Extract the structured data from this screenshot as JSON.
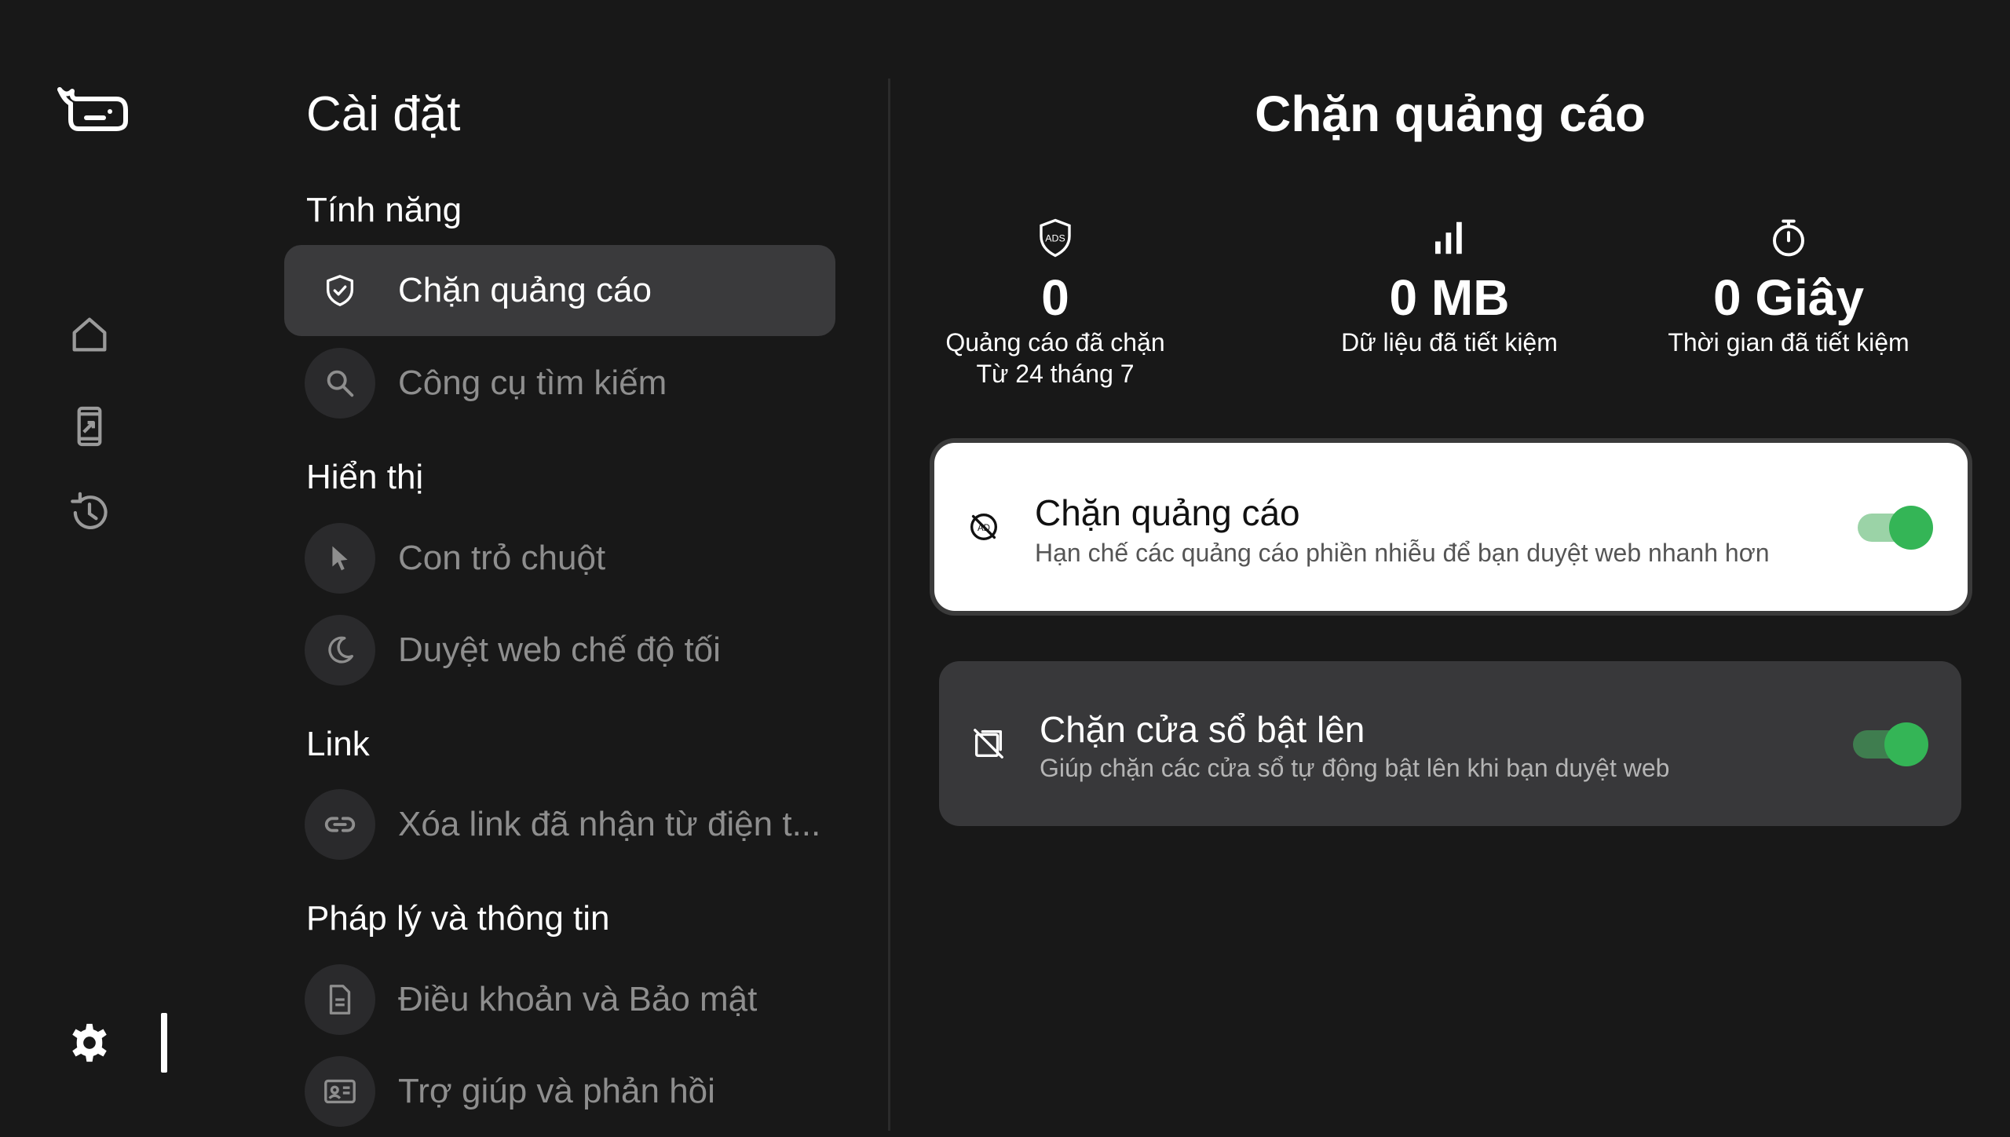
{
  "settings": {
    "title": "Cài đặt",
    "sections": {
      "features": "Tính năng",
      "display": "Hiển thị",
      "link": "Link",
      "legal": "Pháp lý và thông tin"
    },
    "items": {
      "adblock": "Chặn quảng cáo",
      "search": "Công cụ tìm kiếm",
      "cursor": "Con trỏ chuột",
      "dark": "Duyệt web chế độ tối",
      "clear_link": "Xóa link đã nhận từ điện t...",
      "terms": "Điều khoản và Bảo mật",
      "help": "Trợ giúp và phản hồi"
    }
  },
  "panel": {
    "title": "Chặn quảng cáo",
    "stats": [
      {
        "icon": "ads-shield-icon",
        "value": "0",
        "caption1": "Quảng cáo đã chặn",
        "caption2": "Từ 24 tháng 7"
      },
      {
        "icon": "bar-chart-icon",
        "value": "0 MB",
        "caption1": "Dữ liệu đã tiết kiệm"
      },
      {
        "icon": "stopwatch-icon",
        "value": "0 Giây",
        "caption1": "Thời gian đã tiết kiệm"
      }
    ],
    "cards": [
      {
        "title": "Chặn quảng cáo",
        "subtitle": "Hạn chế các quảng cáo phiền nhiễu để bạn duyệt web nhanh hơn",
        "enabled": true
      },
      {
        "title": "Chặn cửa sổ bật lên",
        "subtitle": "Giúp chặn các cửa sổ tự động bật lên khi bạn duyệt web",
        "enabled": true
      }
    ]
  },
  "colors": {
    "background": "#181818",
    "accent_green": "#34b556",
    "active_item": "#3a3a3c"
  }
}
